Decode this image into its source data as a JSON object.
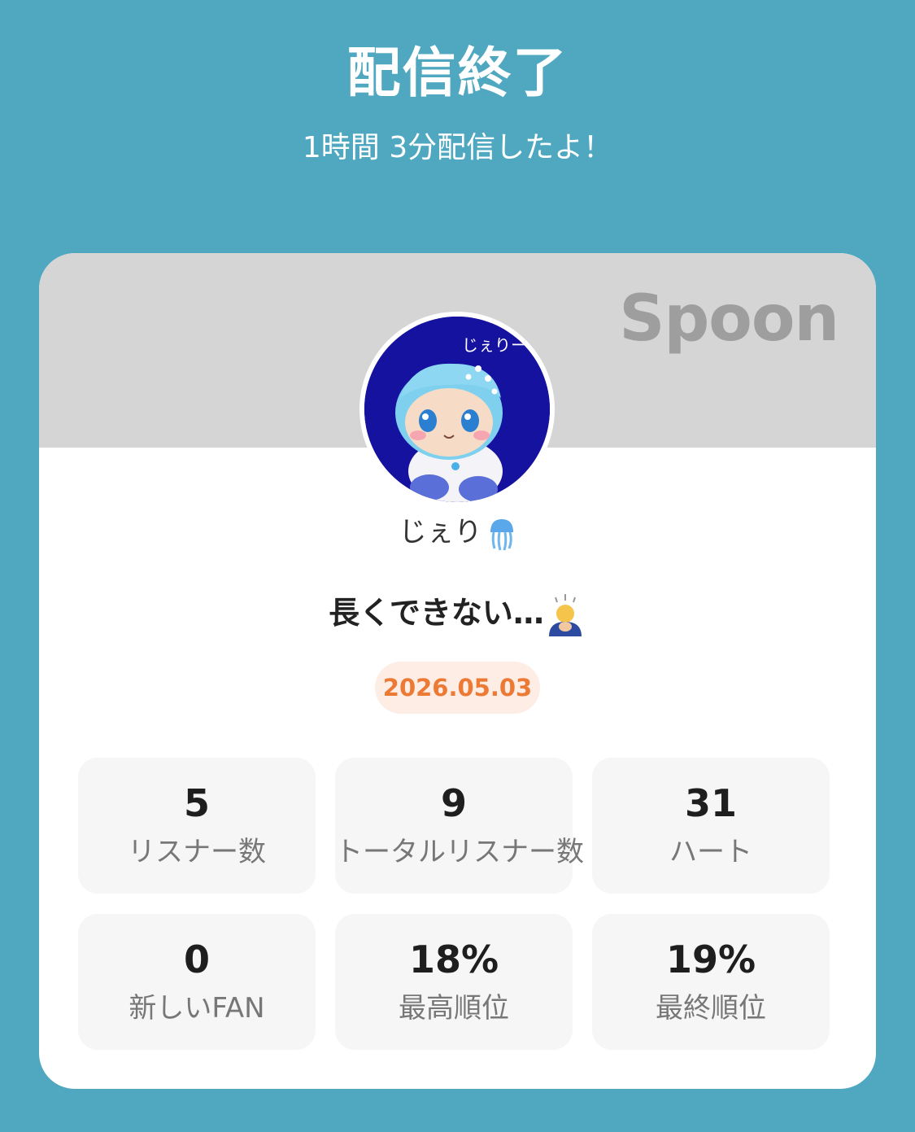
{
  "header": {
    "title": "配信終了",
    "subtitle": "1時間 3分配信したよ！"
  },
  "card": {
    "brand": "Spoon",
    "avatar_text": "じぇりー",
    "username": "じぇり",
    "username_icon": "jellyfish-icon",
    "broadcast_title": "長くできない…",
    "broadcast_title_icon": "bowing-person-icon",
    "date": "2026.05.03"
  },
  "stats": [
    {
      "value": "5",
      "label": "リスナー数"
    },
    {
      "value": "9",
      "label": "トータルリスナー数"
    },
    {
      "value": "31",
      "label": "ハート"
    },
    {
      "value": "0",
      "label": "新しいFAN"
    },
    {
      "value": "18%",
      "label": "最高順位"
    },
    {
      "value": "19%",
      "label": "最終順位"
    }
  ],
  "colors": {
    "background": "#4fa8c0",
    "banner": "#d5d5d5",
    "date_text": "#ec7a35",
    "date_bg": "#fdede4",
    "avatar_bg": "#1612a0"
  }
}
